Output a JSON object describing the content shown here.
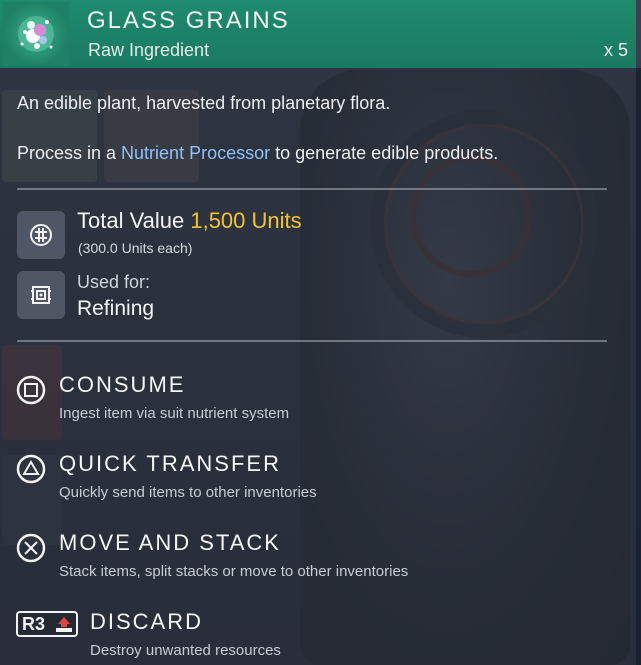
{
  "item": {
    "name": "GLASS GRAINS",
    "category": "Raw Ingredient",
    "quantity": "x 5",
    "icon": "glass-grains-icon"
  },
  "description": {
    "line1": "An edible plant, harvested from planetary flora.",
    "line2_prefix": "Process in a ",
    "line2_link": "Nutrient Processor",
    "line2_suffix": " to generate edible products."
  },
  "value": {
    "label": "Total Value ",
    "amount": "1,500 Units",
    "each": "(300.0 Units each)",
    "icon": "units-icon"
  },
  "usage": {
    "label": "Used for:",
    "value": "Refining",
    "icon": "refiner-icon"
  },
  "actions": [
    {
      "button": "square-button-icon",
      "title": "CONSUME",
      "desc": "Ingest item via suit nutrient system"
    },
    {
      "button": "triangle-button-icon",
      "title": "QUICK TRANSFER",
      "desc": "Quickly send items to other inventories"
    },
    {
      "button": "cross-button-icon",
      "title": "MOVE AND STACK",
      "desc": "Stack items, split stacks or move to other inventories"
    },
    {
      "button": "r3-button-icon",
      "title": "DISCARD",
      "desc": "Destroy unwanted resources",
      "button_text": "R3"
    }
  ],
  "colors": {
    "header": "#1f8a6e",
    "value_accent": "#f5c232",
    "link": "#8fc1f5"
  }
}
